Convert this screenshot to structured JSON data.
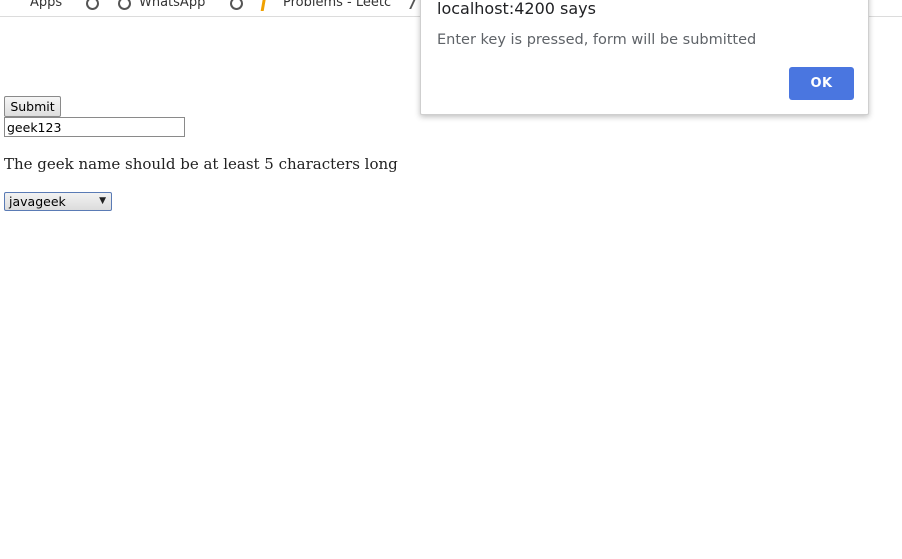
{
  "bookmarks": [
    {
      "label": "Apps",
      "icon": "apps-icon"
    },
    {
      "label": "",
      "icon": "globe-icon"
    },
    {
      "label": "WhatsApp",
      "icon": "whatsapp-icon"
    },
    {
      "label": "",
      "icon": "globe-icon"
    },
    {
      "label": "Problems - Leetc",
      "icon": "leetcode-icon"
    }
  ],
  "form": {
    "submit_label": "Submit",
    "name_value": "geek123",
    "error_message": "The geek name should be at least 5 characters long",
    "select_value": "javageek"
  },
  "dialog": {
    "title": "localhost:4200 says",
    "message": "Enter key is pressed, form will be submitted",
    "ok_label": "OK",
    "ok_color": "#4a76e0"
  }
}
